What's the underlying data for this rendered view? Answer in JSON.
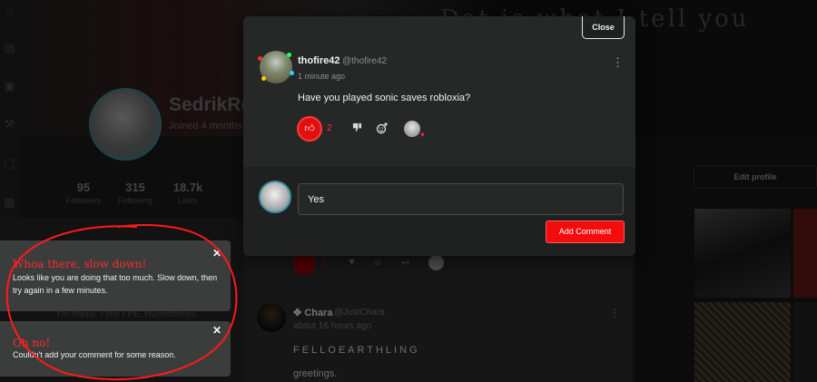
{
  "background": {
    "banner_text": "Dat is what I tell you",
    "profile_name": "SedrikRe",
    "joined": "Joined 4 months",
    "stats": [
      {
        "value": "95",
        "label": "Followers"
      },
      {
        "value": "315",
        "label": "Following"
      },
      {
        "value": "18.7k",
        "label": "Likes"
      }
    ],
    "bio_fragment": "I'm happy. I like FPE, Humorbrews.",
    "edit_profile_label": "Edit profile",
    "sidebar_icons": [
      "home-icon",
      "store-icon",
      "bag-icon",
      "hammer-icon",
      "chat-icon",
      "grid-icon"
    ]
  },
  "modal": {
    "close_label": "Close",
    "post": {
      "author_name": "thofire42",
      "author_handle": "@thofire42",
      "time": "1 minute ago",
      "text": "Have you played sonic saves robloxia?",
      "like_count": "2",
      "menu_glyph": "⋮"
    },
    "comment": {
      "input_value": "Yes",
      "submit_label": "Add Comment"
    }
  },
  "feed": {
    "item1_like_count": "2",
    "item2": {
      "author_name": "Chara",
      "author_prefix": "✥",
      "author_handle": "@JustChara",
      "time": "about 16 hours ago",
      "title": "FELLOEARTHLING",
      "body": "greetings."
    }
  },
  "toasts": [
    {
      "title": "Whoa there, slow down!",
      "message": "Looks like you are doing that too much. Slow down, then try again in a few minutes."
    },
    {
      "title": "Oh no!",
      "message": "Couldn't add your comment for some reason."
    }
  ],
  "colors": {
    "accent_red": "#f20c0c",
    "toast_title_red": "#ff2a2a",
    "modal_bg": "#1f2121",
    "annotation_red": "#ff1a1a"
  }
}
